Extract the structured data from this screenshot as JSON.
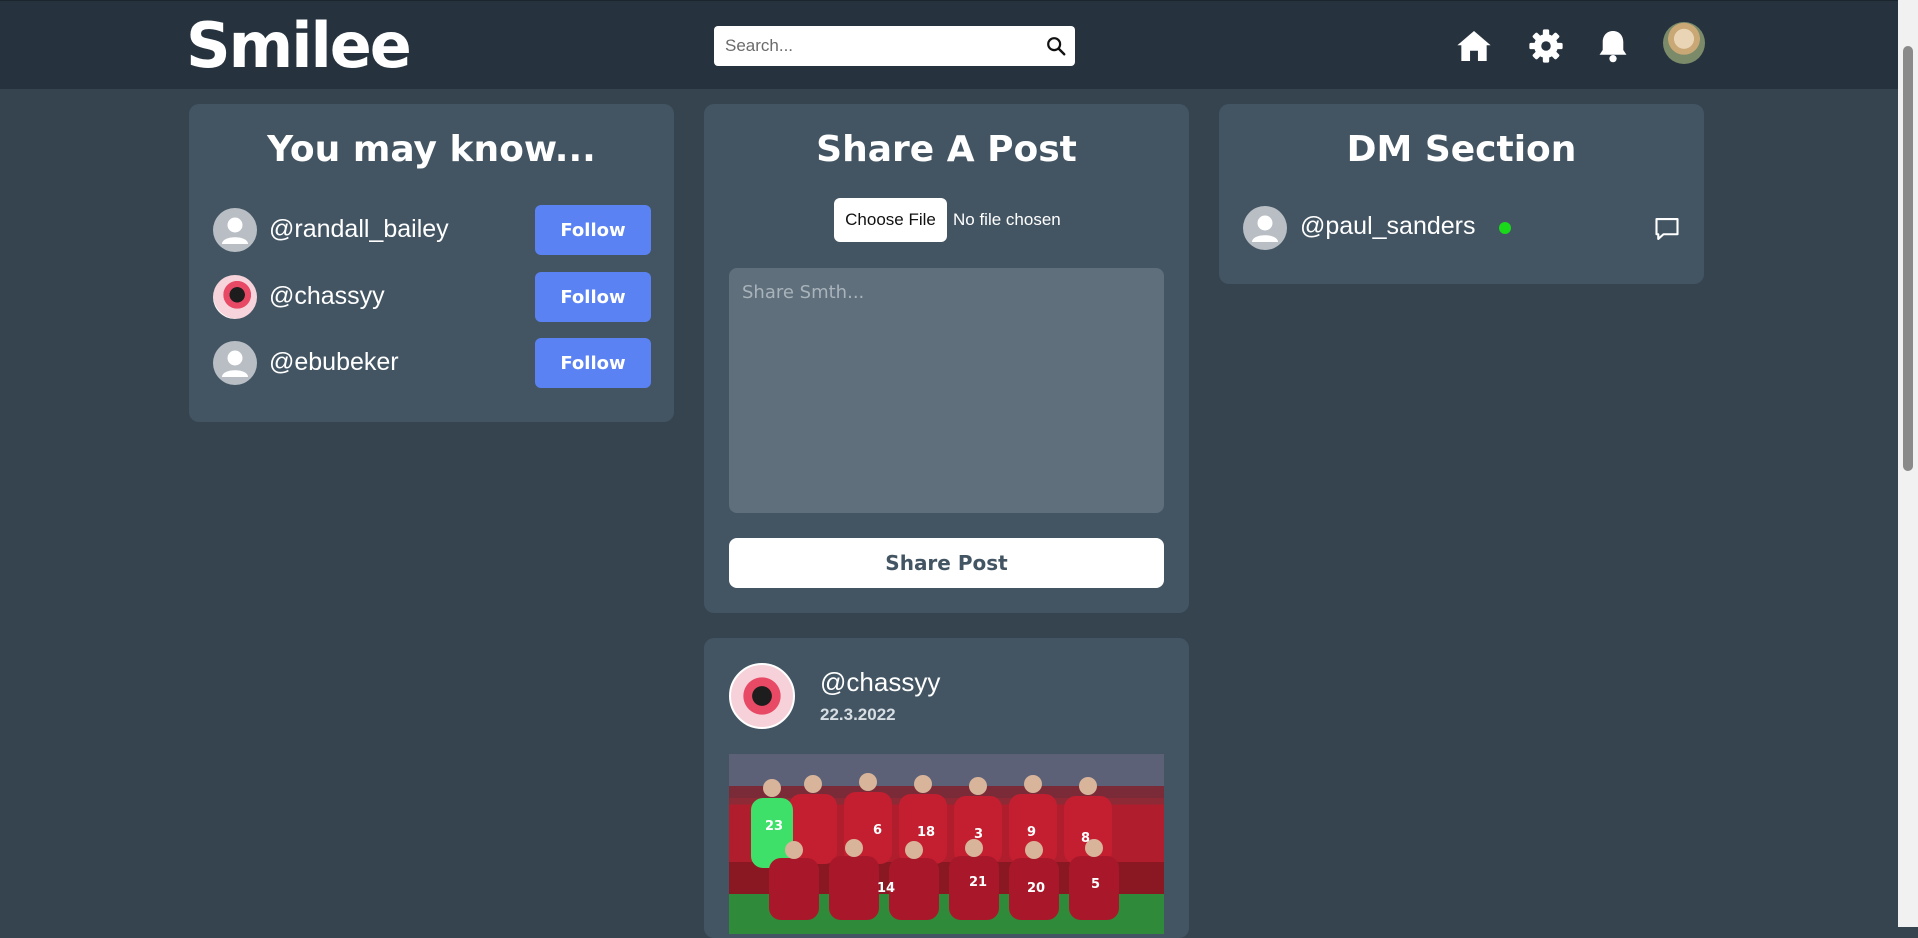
{
  "header": {
    "logo": "Smilee",
    "search_placeholder": "Search..."
  },
  "suggestions": {
    "title": "You may know...",
    "items": [
      {
        "username": "@randall_bailey",
        "button": "Follow"
      },
      {
        "username": "@chassyy",
        "button": "Follow"
      },
      {
        "username": "@ebubeker",
        "button": "Follow"
      }
    ]
  },
  "share": {
    "title": "Share A Post",
    "file_button": "Choose File",
    "file_status": "No file chosen",
    "textarea_placeholder": "Share Smth...",
    "submit": "Share Post"
  },
  "dm": {
    "title": "DM Section",
    "contacts": [
      {
        "username": "@paul_sanders",
        "online": true
      }
    ]
  },
  "post": {
    "username": "@chassyy",
    "date": "22.3.2022",
    "jersey_numbers": [
      "23",
      "6",
      "18",
      "3",
      "9",
      "8",
      "14",
      "21",
      "20",
      "5"
    ]
  },
  "colors": {
    "background": "#36444f",
    "topbar": "#26333e",
    "card": "#435563",
    "follow_button": "#5b82f2",
    "online": "#1ad81a"
  }
}
